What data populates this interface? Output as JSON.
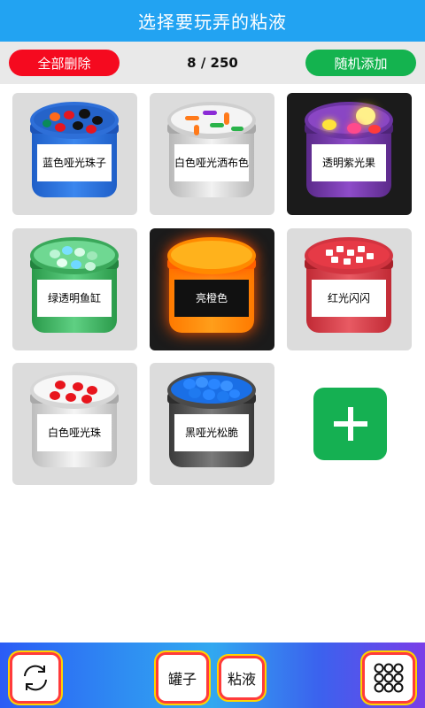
{
  "header": {
    "title": "选择要玩弄的粘液"
  },
  "actions": {
    "delete_all_label": "全部删除",
    "count": "8 / 250",
    "random_add_label": "随机添加"
  },
  "slimes": [
    {
      "label": "蓝色哑光珠子",
      "theme": "blue"
    },
    {
      "label": "白色哑光洒布色",
      "theme": "white-sprinkles"
    },
    {
      "label": "透明紫光果",
      "theme": "purple-glow"
    },
    {
      "label": "绿透明鱼缸",
      "theme": "green"
    },
    {
      "label": "亮橙色",
      "theme": "orange-glow"
    },
    {
      "label": "红光闪闪",
      "theme": "red"
    },
    {
      "label": "白色哑光珠",
      "theme": "white-red-beads"
    },
    {
      "label": "黑哑光松脆",
      "theme": "black-blue-beads"
    }
  ],
  "add_slime_icon": "plus-icon",
  "bottom": {
    "refresh_icon": "refresh-icon",
    "jar_tab_label": "罐子",
    "slime_tab_label": "粘液",
    "grid_icon": "grid-icon"
  },
  "colors": {
    "header": "#22a3f2",
    "delete": "#f50a1f",
    "add": "#15b052"
  }
}
